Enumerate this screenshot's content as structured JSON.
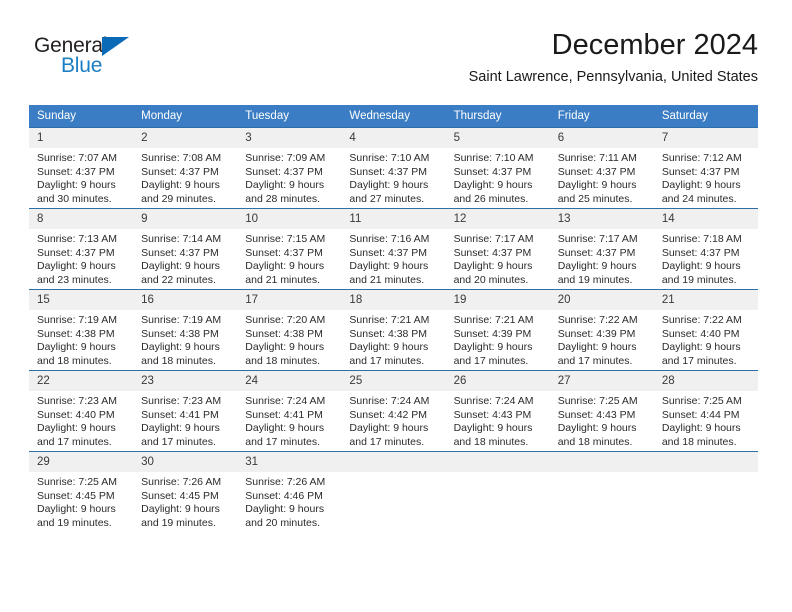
{
  "brand": {
    "name_dark": "General",
    "name_blue": "Blue",
    "accent_color": "#1d7fc3",
    "triangle_color": "#0b6ab8"
  },
  "header": {
    "month_title": "December 2024",
    "location": "Saint Lawrence, Pennsylvania, United States"
  },
  "colors": {
    "header_row_bg": "#3b7dc4",
    "header_row_text": "#ffffff",
    "day_number_bg": "#f0f0f0",
    "row_divider": "#2e6da8",
    "body_text": "#2b2b2b"
  },
  "calendar": {
    "weekday_headers": [
      "Sunday",
      "Monday",
      "Tuesday",
      "Wednesday",
      "Thursday",
      "Friday",
      "Saturday"
    ],
    "weeks": [
      [
        {
          "day": "1",
          "sunrise": "Sunrise: 7:07 AM",
          "sunset": "Sunset: 4:37 PM",
          "daylight_1": "Daylight: 9 hours",
          "daylight_2": "and 30 minutes."
        },
        {
          "day": "2",
          "sunrise": "Sunrise: 7:08 AM",
          "sunset": "Sunset: 4:37 PM",
          "daylight_1": "Daylight: 9 hours",
          "daylight_2": "and 29 minutes."
        },
        {
          "day": "3",
          "sunrise": "Sunrise: 7:09 AM",
          "sunset": "Sunset: 4:37 PM",
          "daylight_1": "Daylight: 9 hours",
          "daylight_2": "and 28 minutes."
        },
        {
          "day": "4",
          "sunrise": "Sunrise: 7:10 AM",
          "sunset": "Sunset: 4:37 PM",
          "daylight_1": "Daylight: 9 hours",
          "daylight_2": "and 27 minutes."
        },
        {
          "day": "5",
          "sunrise": "Sunrise: 7:10 AM",
          "sunset": "Sunset: 4:37 PM",
          "daylight_1": "Daylight: 9 hours",
          "daylight_2": "and 26 minutes."
        },
        {
          "day": "6",
          "sunrise": "Sunrise: 7:11 AM",
          "sunset": "Sunset: 4:37 PM",
          "daylight_1": "Daylight: 9 hours",
          "daylight_2": "and 25 minutes."
        },
        {
          "day": "7",
          "sunrise": "Sunrise: 7:12 AM",
          "sunset": "Sunset: 4:37 PM",
          "daylight_1": "Daylight: 9 hours",
          "daylight_2": "and 24 minutes."
        }
      ],
      [
        {
          "day": "8",
          "sunrise": "Sunrise: 7:13 AM",
          "sunset": "Sunset: 4:37 PM",
          "daylight_1": "Daylight: 9 hours",
          "daylight_2": "and 23 minutes."
        },
        {
          "day": "9",
          "sunrise": "Sunrise: 7:14 AM",
          "sunset": "Sunset: 4:37 PM",
          "daylight_1": "Daylight: 9 hours",
          "daylight_2": "and 22 minutes."
        },
        {
          "day": "10",
          "sunrise": "Sunrise: 7:15 AM",
          "sunset": "Sunset: 4:37 PM",
          "daylight_1": "Daylight: 9 hours",
          "daylight_2": "and 21 minutes."
        },
        {
          "day": "11",
          "sunrise": "Sunrise: 7:16 AM",
          "sunset": "Sunset: 4:37 PM",
          "daylight_1": "Daylight: 9 hours",
          "daylight_2": "and 21 minutes."
        },
        {
          "day": "12",
          "sunrise": "Sunrise: 7:17 AM",
          "sunset": "Sunset: 4:37 PM",
          "daylight_1": "Daylight: 9 hours",
          "daylight_2": "and 20 minutes."
        },
        {
          "day": "13",
          "sunrise": "Sunrise: 7:17 AM",
          "sunset": "Sunset: 4:37 PM",
          "daylight_1": "Daylight: 9 hours",
          "daylight_2": "and 19 minutes."
        },
        {
          "day": "14",
          "sunrise": "Sunrise: 7:18 AM",
          "sunset": "Sunset: 4:37 PM",
          "daylight_1": "Daylight: 9 hours",
          "daylight_2": "and 19 minutes."
        }
      ],
      [
        {
          "day": "15",
          "sunrise": "Sunrise: 7:19 AM",
          "sunset": "Sunset: 4:38 PM",
          "daylight_1": "Daylight: 9 hours",
          "daylight_2": "and 18 minutes."
        },
        {
          "day": "16",
          "sunrise": "Sunrise: 7:19 AM",
          "sunset": "Sunset: 4:38 PM",
          "daylight_1": "Daylight: 9 hours",
          "daylight_2": "and 18 minutes."
        },
        {
          "day": "17",
          "sunrise": "Sunrise: 7:20 AM",
          "sunset": "Sunset: 4:38 PM",
          "daylight_1": "Daylight: 9 hours",
          "daylight_2": "and 18 minutes."
        },
        {
          "day": "18",
          "sunrise": "Sunrise: 7:21 AM",
          "sunset": "Sunset: 4:38 PM",
          "daylight_1": "Daylight: 9 hours",
          "daylight_2": "and 17 minutes."
        },
        {
          "day": "19",
          "sunrise": "Sunrise: 7:21 AM",
          "sunset": "Sunset: 4:39 PM",
          "daylight_1": "Daylight: 9 hours",
          "daylight_2": "and 17 minutes."
        },
        {
          "day": "20",
          "sunrise": "Sunrise: 7:22 AM",
          "sunset": "Sunset: 4:39 PM",
          "daylight_1": "Daylight: 9 hours",
          "daylight_2": "and 17 minutes."
        },
        {
          "day": "21",
          "sunrise": "Sunrise: 7:22 AM",
          "sunset": "Sunset: 4:40 PM",
          "daylight_1": "Daylight: 9 hours",
          "daylight_2": "and 17 minutes."
        }
      ],
      [
        {
          "day": "22",
          "sunrise": "Sunrise: 7:23 AM",
          "sunset": "Sunset: 4:40 PM",
          "daylight_1": "Daylight: 9 hours",
          "daylight_2": "and 17 minutes."
        },
        {
          "day": "23",
          "sunrise": "Sunrise: 7:23 AM",
          "sunset": "Sunset: 4:41 PM",
          "daylight_1": "Daylight: 9 hours",
          "daylight_2": "and 17 minutes."
        },
        {
          "day": "24",
          "sunrise": "Sunrise: 7:24 AM",
          "sunset": "Sunset: 4:41 PM",
          "daylight_1": "Daylight: 9 hours",
          "daylight_2": "and 17 minutes."
        },
        {
          "day": "25",
          "sunrise": "Sunrise: 7:24 AM",
          "sunset": "Sunset: 4:42 PM",
          "daylight_1": "Daylight: 9 hours",
          "daylight_2": "and 17 minutes."
        },
        {
          "day": "26",
          "sunrise": "Sunrise: 7:24 AM",
          "sunset": "Sunset: 4:43 PM",
          "daylight_1": "Daylight: 9 hours",
          "daylight_2": "and 18 minutes."
        },
        {
          "day": "27",
          "sunrise": "Sunrise: 7:25 AM",
          "sunset": "Sunset: 4:43 PM",
          "daylight_1": "Daylight: 9 hours",
          "daylight_2": "and 18 minutes."
        },
        {
          "day": "28",
          "sunrise": "Sunrise: 7:25 AM",
          "sunset": "Sunset: 4:44 PM",
          "daylight_1": "Daylight: 9 hours",
          "daylight_2": "and 18 minutes."
        }
      ],
      [
        {
          "day": "29",
          "sunrise": "Sunrise: 7:25 AM",
          "sunset": "Sunset: 4:45 PM",
          "daylight_1": "Daylight: 9 hours",
          "daylight_2": "and 19 minutes."
        },
        {
          "day": "30",
          "sunrise": "Sunrise: 7:26 AM",
          "sunset": "Sunset: 4:45 PM",
          "daylight_1": "Daylight: 9 hours",
          "daylight_2": "and 19 minutes."
        },
        {
          "day": "31",
          "sunrise": "Sunrise: 7:26 AM",
          "sunset": "Sunset: 4:46 PM",
          "daylight_1": "Daylight: 9 hours",
          "daylight_2": "and 20 minutes."
        },
        {
          "day": "",
          "sunrise": "",
          "sunset": "",
          "daylight_1": "",
          "daylight_2": ""
        },
        {
          "day": "",
          "sunrise": "",
          "sunset": "",
          "daylight_1": "",
          "daylight_2": ""
        },
        {
          "day": "",
          "sunrise": "",
          "sunset": "",
          "daylight_1": "",
          "daylight_2": ""
        },
        {
          "day": "",
          "sunrise": "",
          "sunset": "",
          "daylight_1": "",
          "daylight_2": ""
        }
      ]
    ]
  }
}
